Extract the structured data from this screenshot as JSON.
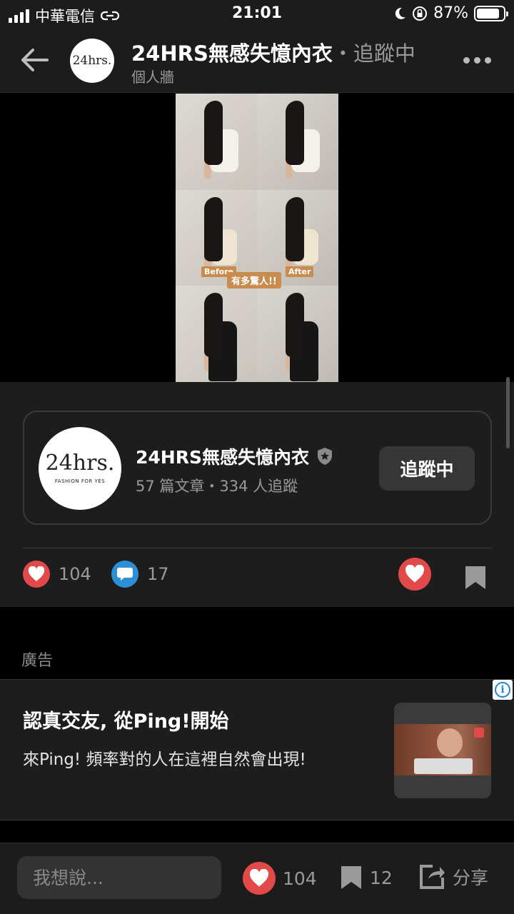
{
  "status_bar": {
    "carrier": "中華電信",
    "time": "21:01",
    "battery": "87%",
    "battery_level": 0.87
  },
  "header": {
    "page_name": "24HRS無感失憶內衣",
    "follow_state": "・追蹤中",
    "subtitle": "個人牆",
    "avatar_text": "24hrs."
  },
  "post_image": {
    "before_label": "Before",
    "after_label": "After",
    "caption_label": "有多驚人!!"
  },
  "author_card": {
    "avatar_logo": "24hrs.",
    "avatar_tagline": "FASHION FOR YES",
    "name": "24HRS無感失憶內衣",
    "stats": "57 篇文章・334 人追蹤",
    "follow_label": "追蹤中"
  },
  "actions": {
    "like_count": "104",
    "comment_count": "17"
  },
  "ad": {
    "section_label": "廣告",
    "title": "認真交友, 從Ping!開始",
    "description": "來Ping! 頻率對的人在這裡自然會出現!",
    "info_glyph": "i"
  },
  "bottom_bar": {
    "input_placeholder": "我想說...",
    "like_count": "104",
    "bookmark_count": "12",
    "share_label": "分享"
  },
  "colors": {
    "like_red": "#e24a4a",
    "comment_blue": "#2d8fd6",
    "ad_info_blue": "#1e88c9",
    "accent_tag": "#c98b4e"
  }
}
